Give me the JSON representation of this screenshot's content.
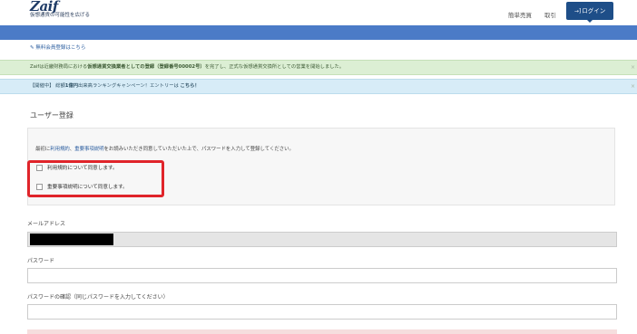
{
  "header": {
    "logo": "Zaif",
    "tagline": "仮想通貨の可能性を広げる",
    "nav_simple": "簡単売買",
    "nav_trade": "取引",
    "login_icon": "→]",
    "login_label": "ログイン"
  },
  "signup_link": {
    "icon": "✎",
    "label": "無料会員登録はこちら"
  },
  "notices": {
    "green_pre": "Zaifは近畿財務局における",
    "green_bold": "仮想通貨交換業者としての登録（登録番号00002号）",
    "green_post": "を完了し、正式な仮想通貨交換所としての営業を開始しました。",
    "blue_pre": "【開催中】 総額",
    "blue_bold1": "1億円",
    "blue_mid": "出来高ランキングキャンペーン！エントリーは ",
    "blue_bold2": "こちら！",
    "close": "×"
  },
  "form": {
    "title": "ユーザー登録",
    "terms_pre": "最初に",
    "terms_link1": "利用規約",
    "terms_sep": "、",
    "terms_link2": "重要事項説明",
    "terms_post": "をお読みいただき同意していただいた上で、パスワードを入力して登録してください。",
    "check1": "利用規約について同意します。",
    "check2": "重要事項説明について同意します。",
    "email_label": "メールアドレス",
    "password_label": "パスワード",
    "password_confirm_label": "パスワードの確認（同じパスワードを入力してください）"
  },
  "colors": {
    "brand": "#1e4e88",
    "topbar": "#4b7bc7",
    "highlight": "#e0242a"
  }
}
